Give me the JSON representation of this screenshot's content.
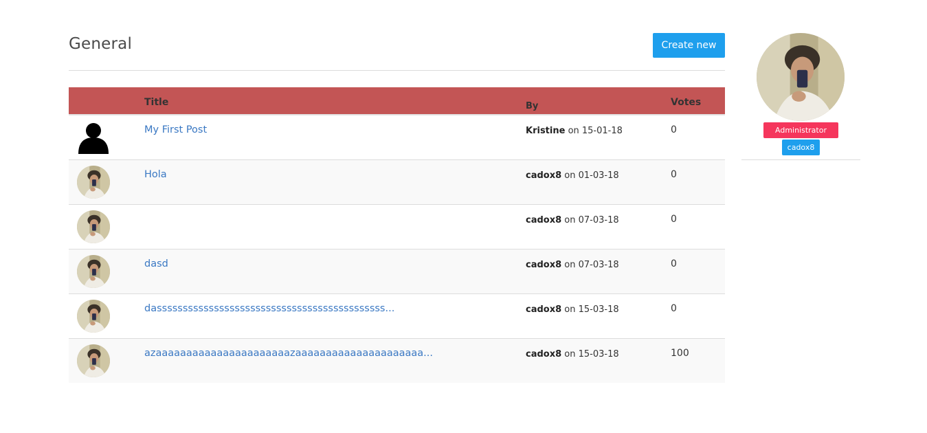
{
  "page": {
    "title": "General",
    "create_label": "Create new"
  },
  "table": {
    "headers": [
      "",
      "Title",
      "By",
      "Votes"
    ],
    "rows": [
      {
        "avatar": "user-silhouette-icon",
        "title": "My First Post",
        "author": "Kristine",
        "on": "on 15-01-18",
        "votes": "0"
      },
      {
        "avatar": "user-photo",
        "title": "Hola",
        "author": "cadox8",
        "on": "on 01-03-18",
        "votes": "0"
      },
      {
        "avatar": "user-photo",
        "title": "",
        "author": "cadox8",
        "on": "on 07-03-18",
        "votes": "0"
      },
      {
        "avatar": "user-photo",
        "title": "dasd",
        "author": "cadox8",
        "on": "on 07-03-18",
        "votes": "0"
      },
      {
        "avatar": "user-photo",
        "title": "dassssssssssssssssssssssssssssssssssssssssssss...",
        "author": "cadox8",
        "on": "on 15-03-18",
        "votes": "0"
      },
      {
        "avatar": "user-photo",
        "title": "azaaaaaaaaaaaaaaaaaaaaaazaaaaaaaaaaaaaaaaaaaaa...",
        "author": "cadox8",
        "on": "on 15-03-18",
        "votes": "100"
      }
    ]
  },
  "profile": {
    "role": "Administrator",
    "username": "cadox8"
  },
  "colors": {
    "header_bg": "#c35555",
    "primary": "#1e9fed",
    "danger": "#f5365c",
    "link": "#3a78c3"
  }
}
